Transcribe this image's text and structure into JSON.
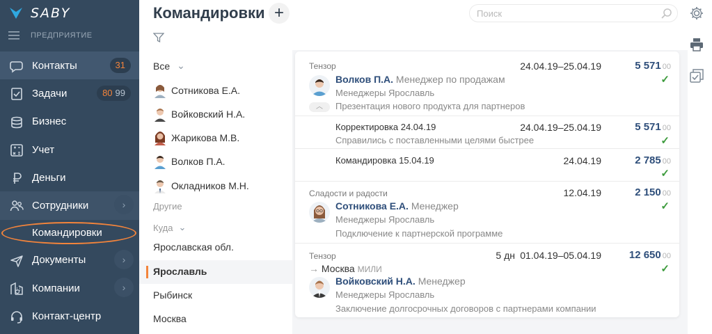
{
  "sidebar": {
    "logo": "SABY",
    "company": "ПРЕДПРИЯТИЕ",
    "items": [
      {
        "label": "Контакты",
        "icon": "chat-icon",
        "badge": "31"
      },
      {
        "label": "Задачи",
        "icon": "tasks-icon",
        "badge_new": "80",
        "badge_total": "99"
      },
      {
        "label": "Бизнес",
        "icon": "business-icon"
      },
      {
        "label": "Учет",
        "icon": "accounting-icon"
      },
      {
        "label": "Деньги",
        "icon": "ruble-icon"
      },
      {
        "label": "Сотрудники",
        "icon": "employees-icon"
      },
      {
        "label": "Командировки",
        "sub": true
      },
      {
        "label": "Документы",
        "icon": "documents-icon"
      },
      {
        "label": "Компании",
        "icon": "companies-icon"
      },
      {
        "label": "Контакт-центр",
        "icon": "headset-icon"
      }
    ]
  },
  "header": {
    "title": "Командировки",
    "search_placeholder": "Поиск"
  },
  "filter_panel": {
    "all": "Все",
    "people": [
      "Сотникова Е.А.",
      "Войковский Н.А.",
      "Жарикова М.В.",
      "Волков П.А.",
      "Окладников М.Н."
    ],
    "other": "Другие",
    "where": "Куда",
    "places": [
      "Ярославская обл.",
      "Ярославль",
      "Рыбинск",
      "Москва"
    ],
    "active_place": "Ярославль"
  },
  "trips": [
    {
      "org": "Тензор",
      "date": "24.04.19–25.04.19",
      "amount": "5 571",
      "amount_dec": "00",
      "name": "Волков П.А.",
      "position": "Менеджер по продажам",
      "dept": "Менеджеры Ярославль",
      "descr": "Презентация нового продукта для партнеров",
      "children": [
        {
          "title": "Корректировка 24.04.19",
          "date": "24.04.19–25.04.19",
          "amount": "5 571",
          "amount_dec": "00",
          "descr": "Справились с поставленными целями быстрее"
        },
        {
          "title": "Командировка 15.04.19",
          "date": "24.04.19",
          "amount": "2 785",
          "amount_dec": "00"
        }
      ]
    },
    {
      "org": "Сладости и радости",
      "date": "12.04.19",
      "amount": "2 150",
      "amount_dec": "00",
      "name": "Сотникова Е.А.",
      "position": "Менеджер",
      "dept": "Менеджеры Ярославль",
      "descr": "Подключение к партнерской программе"
    },
    {
      "org": "Тензор",
      "days": "5 дн",
      "date": "01.04.19–05.04.19",
      "amount": "12 650",
      "amount_dec": "00",
      "route_to": "Москва",
      "route_tag": "МИЛИ",
      "name": "Войковский Н.А.",
      "position": "Менеджер",
      "dept": "Менеджеры Ярославль",
      "descr": "Заключение долгосрочных договоров с партнерами компании"
    }
  ],
  "colors": {
    "sidebar": "#34495e",
    "accent": "#f3843b",
    "amount": "#2e4e7a",
    "check": "#3c9b3c"
  }
}
